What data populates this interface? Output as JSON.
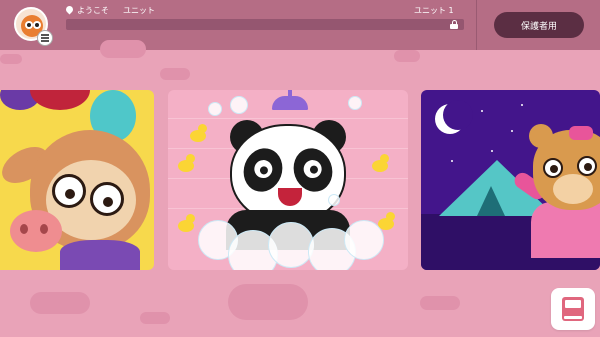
{
  "header": {
    "location_label": "ようこそ",
    "unit_name": "ユニット",
    "unit_number_label": "ユニット 1",
    "progress": 0.0,
    "parent_button_label": "保護者用"
  },
  "lessons": [
    {
      "name": "card1"
    },
    {
      "name": "card2"
    },
    {
      "name": "card3"
    }
  ],
  "colors": {
    "topbar": "#b56d85",
    "background": "#e9a3b8",
    "parent_button": "#5b2e43",
    "progress_track": "#955670"
  },
  "icons": [
    "avatar-owl-icon",
    "menu-icon",
    "location-pin-icon",
    "lock-icon",
    "book-icon"
  ]
}
